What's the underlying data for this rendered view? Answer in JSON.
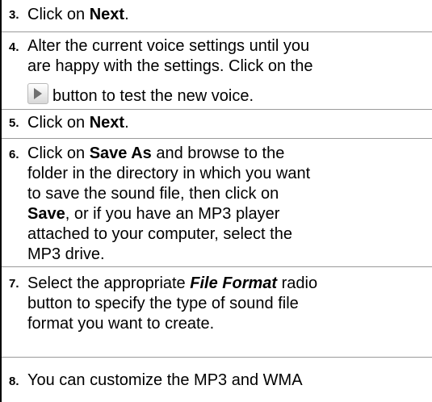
{
  "steps": [
    {
      "number": "3.",
      "text_before": "Click on ",
      "bold": "Next",
      "text_after": "."
    },
    {
      "number": "4.",
      "line1": "Alter the current voice settings until you",
      "line2": "are happy with the settings. Click on the",
      "line3": "button to test the new voice.",
      "icon": "play-icon"
    },
    {
      "number": "5.",
      "text_before": "Click on ",
      "bold": "Next",
      "text_after": "."
    },
    {
      "number": "6.",
      "l1_before": "Click on ",
      "l1_bold": "Save As",
      "l1_after": " and browse to the",
      "line2": "folder in the directory in which you want",
      "line3": "to save the sound file, then click on",
      "l4_bold": "Save",
      "l4_after": ", or if you have an MP3 player",
      "line5": "attached to your computer, select the",
      "line6": "MP3 drive."
    },
    {
      "number": "7.",
      "l1_before": "Select the appropriate ",
      "l1_bolditalic": "File Format",
      "l1_after": " radio",
      "line2": "button to specify the type of sound file",
      "line3": "format you want to create."
    },
    {
      "number": "8.",
      "line1": "You can customize the MP3 and WMA"
    }
  ]
}
